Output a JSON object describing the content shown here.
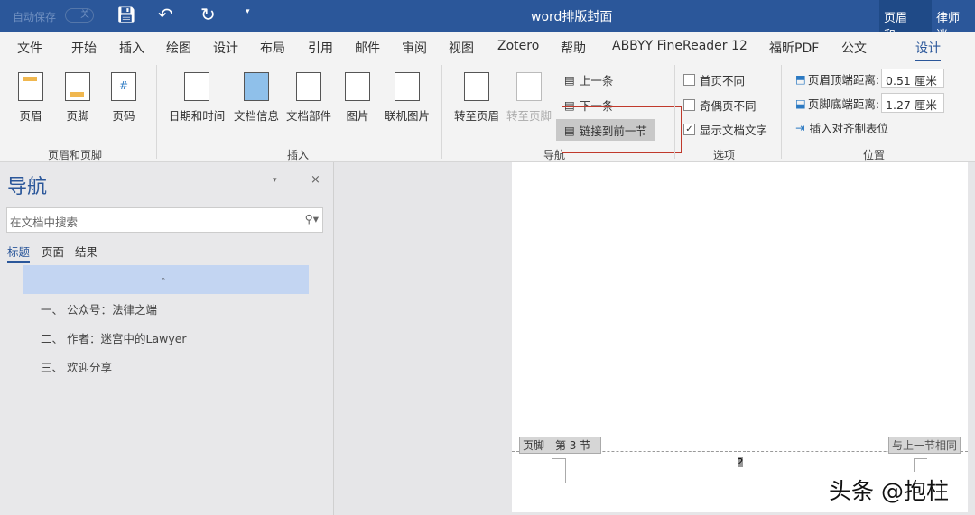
{
  "titlebar": {
    "autosave": "自动保存",
    "autosave_state": "关",
    "doc_title": "word排版封面",
    "context_tab": "页眉和...",
    "user": "律师 迷"
  },
  "tabs": [
    "文件",
    "开始",
    "插入",
    "绘图",
    "设计",
    "布局",
    "引用",
    "邮件",
    "审阅",
    "视图",
    "Zotero",
    "帮助",
    "ABBYY FineReader 12",
    "福昕PDF",
    "公文",
    "设计"
  ],
  "active_tab": "设计",
  "ribbon": {
    "hf": {
      "label": "页眉和页脚",
      "buttons": [
        "页眉",
        "页脚",
        "页码"
      ]
    },
    "insert": {
      "label": "插入",
      "buttons": [
        "日期和时间",
        "文档信息",
        "文档部件",
        "图片",
        "联机图片"
      ]
    },
    "nav": {
      "label": "导航",
      "goto_header": "转至页眉",
      "goto_footer": "转至页脚",
      "prev": "上一条",
      "next": "下一条",
      "link_prev": "链接到前一节"
    },
    "options": {
      "label": "选项",
      "items": [
        {
          "label": "首页不同",
          "checked": false
        },
        {
          "label": "奇偶页不同",
          "checked": false
        },
        {
          "label": "显示文档文字",
          "checked": true
        }
      ]
    },
    "position": {
      "label": "位置",
      "header_dist_label": "页眉顶端距离:",
      "header_dist": "0.51 厘米",
      "footer_dist_label": "页脚底端距离:",
      "footer_dist": "1.27 厘米",
      "insert_tab": "插入对齐制表位"
    }
  },
  "highlight_color": "#c0392b",
  "navpane": {
    "title": "导航",
    "search_placeholder": "在文档中搜索",
    "tabs": [
      "标题",
      "页面",
      "结果"
    ],
    "selected_item": "。",
    "items": [
      "一、 公众号：法律之端",
      "二、 作者：迷宫中的Lawyer",
      "三、 欢迎分享"
    ]
  },
  "page": {
    "footer_label": "页脚 - 第 3 节 -",
    "same_as_prev": "与上一节相同",
    "page_number": "2"
  },
  "watermark": "头条 @抱柱"
}
